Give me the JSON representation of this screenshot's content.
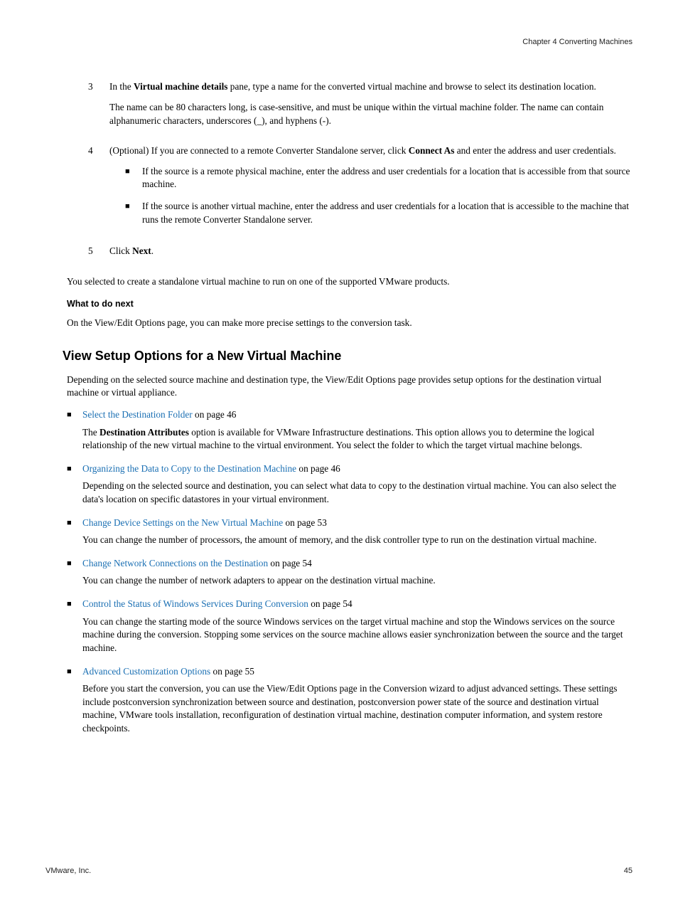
{
  "header": {
    "chapter": "Chapter 4 Converting Machines"
  },
  "steps": {
    "s3": {
      "num": "3",
      "p1a": "In the ",
      "p1b": "Virtual machine details",
      "p1c": " pane, type a name for the converted virtual machine and browse to select its destination location.",
      "p2": "The name can be 80 characters long, is case-sensitive, and must be unique within the virtual machine folder. The name can contain alphanumeric characters, underscores (_), and hyphens (-)."
    },
    "s4": {
      "num": "4",
      "p1a": "(Optional) If you are connected to a remote Converter Standalone server, click ",
      "p1b": "Connect As",
      "p1c": " and enter the address and user credentials.",
      "b1": "If the source is a remote physical machine, enter the address and user credentials for a location that is accessible from that source machine.",
      "b2": "If the source is another virtual machine, enter the address and user credentials for a location that is accessible to the machine that runs the remote Converter Standalone server."
    },
    "s5": {
      "num": "5",
      "p1a": "Click ",
      "p1b": "Next",
      "p1c": "."
    }
  },
  "afterSteps": "You selected to create a standalone virtual machine to run on one of the supported VMware products.",
  "whatNextHeading": "What to do next",
  "whatNextBody": "On the View/Edit Options page, you can make more precise settings to the conversion task.",
  "h2": "View Setup Options for a New Virtual Machine",
  "intro": "Depending on the selected source machine and destination type, the View/Edit Options page provides setup options for the destination virtual machine or virtual appliance.",
  "topics": {
    "t1": {
      "link": "Select the Destination Folder",
      "page": " on page 46",
      "body_a": "The ",
      "body_b": "Destination Attributes",
      "body_c": " option is available for VMware Infrastructure destinations. This option allows you to determine the logical relationship of the new virtual machine to the virtual environment. You select the folder to which the target virtual machine belongs."
    },
    "t2": {
      "link": "Organizing the Data to Copy to the Destination Machine",
      "page": " on page 46",
      "body": "Depending on the selected source and destination, you can select what data to copy to the destination virtual machine. You can also select the data's location on specific datastores in your virtual environment."
    },
    "t3": {
      "link": "Change Device Settings on the New Virtual Machine",
      "page": " on page 53",
      "body": "You can change the number of processors, the amount of memory, and the disk controller type to run on the destination virtual machine."
    },
    "t4": {
      "link": "Change Network Connections on the Destination",
      "page": " on page 54",
      "body": "You can change the number of network adapters to appear on the destination virtual machine."
    },
    "t5": {
      "link": "Control the Status of Windows Services During Conversion",
      "page": " on page 54",
      "body": "You can change the starting mode of the source Windows services on the target virtual machine and stop the Windows services on the source machine during the conversion. Stopping some services on the source machine allows easier synchronization between the source and the target machine."
    },
    "t6": {
      "link": "Advanced Customization Options",
      "page": " on page 55",
      "body": "Before you start the conversion, you can use the View/Edit Options page in the Conversion wizard to adjust advanced settings. These settings include postconversion synchronization between source and destination, postconversion power state of the source and destination virtual machine, VMware tools installation, reconfiguration of destination virtual machine, destination computer information, and system restore checkpoints."
    }
  },
  "footer": {
    "left": "VMware, Inc.",
    "right": "45"
  }
}
